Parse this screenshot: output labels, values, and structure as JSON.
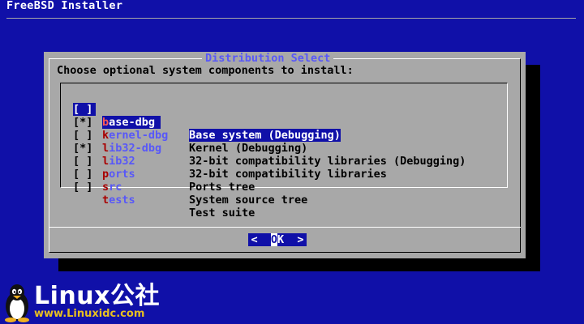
{
  "header": {
    "title": "FreeBSD Installer"
  },
  "dialog": {
    "title": "Distribution Select",
    "prompt": "Choose optional system components to install:",
    "items": [
      {
        "check": "[ ]",
        "name_hot": "b",
        "name_rest": "ase-dbg",
        "desc": "Base system (Debugging)",
        "selected": true
      },
      {
        "check": "[*]",
        "name_hot": "k",
        "name_rest": "ernel-dbg",
        "desc": "Kernel (Debugging)"
      },
      {
        "check": "[ ]",
        "name_hot": "l",
        "name_rest": "ib32-dbg",
        "desc": "32-bit compatibility libraries (Debugging)"
      },
      {
        "check": "[*]",
        "name_hot": "l",
        "name_rest": "ib32",
        "desc": "32-bit compatibility libraries"
      },
      {
        "check": "[ ]",
        "name_hot": "p",
        "name_rest": "orts",
        "desc": "Ports tree"
      },
      {
        "check": "[ ]",
        "name_hot": "s",
        "name_rest": "rc",
        "desc": "System source tree"
      },
      {
        "check": "[ ]",
        "name_hot": "t",
        "name_rest": "ests",
        "desc": "Test suite"
      }
    ],
    "ok": {
      "left": "<  ",
      "cursor": "O",
      "rest": "K  >"
    }
  },
  "watermark": {
    "logo": "Linux公社",
    "url": "www.Linuxidc.com"
  },
  "colors": {
    "background": "#1010a8",
    "dialog": "#a8a8a8",
    "item_name": "#5858f8",
    "hotkey": "#a80000"
  }
}
